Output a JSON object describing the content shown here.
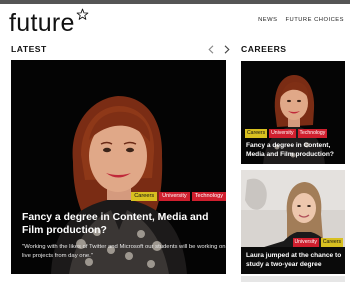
{
  "brand": {
    "logo_text": "future",
    "logo_icon": "star-icon"
  },
  "nav": {
    "items": [
      {
        "label": "NEWS"
      },
      {
        "label": "FUTURE CHOICES"
      }
    ]
  },
  "sections": {
    "latest": "LATEST",
    "careers": "CAREERS"
  },
  "carousel": {
    "prev_icon": "chevron-left-icon",
    "next_icon": "chevron-right-icon"
  },
  "feature": {
    "tags": [
      "Careers",
      "University",
      "Technology"
    ],
    "title": "Fancy a degree in Content, Media and Film production?",
    "description": "\"Working with the likes of Twitter and Microsoft our students will be working on live projects from day one.\""
  },
  "careers_cards": [
    {
      "tags": [
        "Careers",
        "University",
        "Technology"
      ],
      "title": "Fancy a degree in Content, Media and Film production?"
    },
    {
      "tags": [
        "University",
        "Careers"
      ],
      "title": "Laura jumped at the chance to study a two-year degree"
    }
  ],
  "colors": {
    "tag_careers": "#d8c020",
    "tag_red": "#d01f2e",
    "background": "#ffffff",
    "card_dark": "#050505"
  }
}
